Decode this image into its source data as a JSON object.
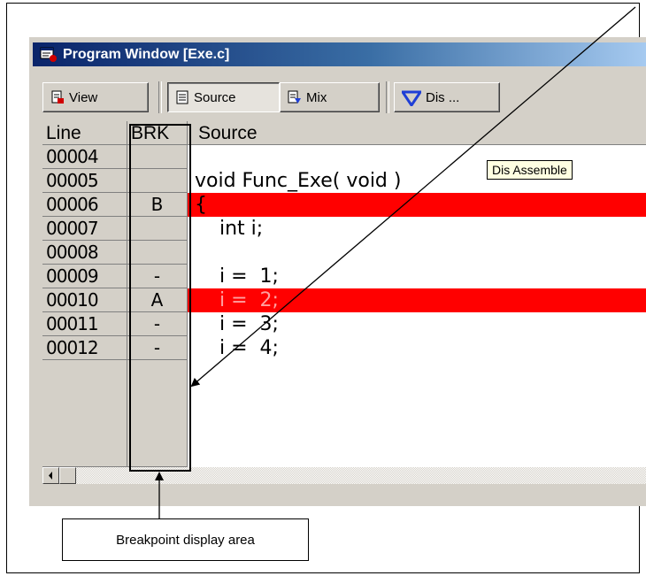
{
  "window": {
    "title": "Program Window [Exe.c]"
  },
  "toolbar": {
    "view_label": "View",
    "source_label": "Source",
    "mix_label": "Mix",
    "dis_label": "Dis ..."
  },
  "grid": {
    "columns": [
      "Line",
      "BRK",
      "Source"
    ],
    "tooltip": "Dis Assemble",
    "rows": [
      {
        "line": "00004",
        "brk": "",
        "source": ""
      },
      {
        "line": "00005",
        "brk": "",
        "source": "void Func_Exe( void )"
      },
      {
        "line": "00006",
        "brk": "B",
        "source": "{"
      },
      {
        "line": "00007",
        "brk": "",
        "source": "    int i;"
      },
      {
        "line": "00008",
        "brk": "",
        "source": ""
      },
      {
        "line": "00009",
        "brk": "-",
        "source": "    i =  1;"
      },
      {
        "line": "00010",
        "brk": "A",
        "source": "    i =  2;"
      },
      {
        "line": "00011",
        "brk": "-",
        "source": "    i =  3;"
      },
      {
        "line": "00012",
        "brk": "-",
        "source": "    i =  4;"
      }
    ]
  },
  "annotation": {
    "callout_label": "Breakpoint display area"
  },
  "colors": {
    "breakpoint_highlight": "#ff0000",
    "titlebar": "#0a246a",
    "window_face": "#d4d0c8"
  }
}
